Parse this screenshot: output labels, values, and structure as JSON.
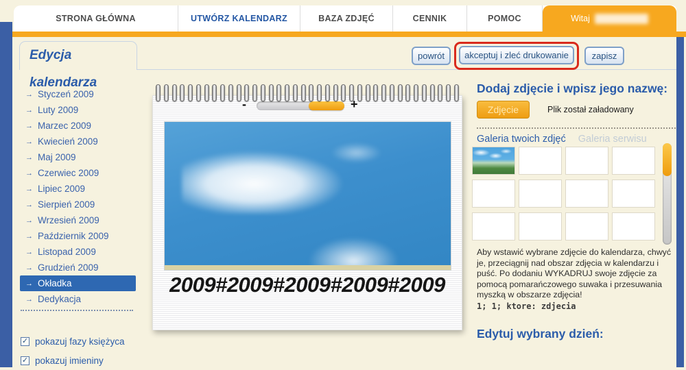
{
  "nav": {
    "tabs": [
      {
        "label": "STRONA GŁÓWNA",
        "active": false
      },
      {
        "label": "UTWÓRZ KALENDARZ",
        "active": true
      },
      {
        "label": "BAZA ZDJĘĆ",
        "active": false
      },
      {
        "label": "CENNIK",
        "active": false
      },
      {
        "label": "POMOC",
        "active": false
      }
    ],
    "welcome_label": "Witaj",
    "welcome_name_redacted": true
  },
  "page": {
    "title": "Edycja kalendarza"
  },
  "toolbar": {
    "back_label": "powrót",
    "accept_label": "akceptuj i zleć drukowanie",
    "save_label": "zapisz"
  },
  "sidebar": {
    "items": [
      {
        "label": "Styczeń 2009",
        "selected": false
      },
      {
        "label": "Luty 2009",
        "selected": false
      },
      {
        "label": "Marzec 2009",
        "selected": false
      },
      {
        "label": "Kwiecień 2009",
        "selected": false
      },
      {
        "label": "Maj 2009",
        "selected": false
      },
      {
        "label": "Czerwiec 2009",
        "selected": false
      },
      {
        "label": "Lipiec 2009",
        "selected": false
      },
      {
        "label": "Sierpień 2009",
        "selected": false
      },
      {
        "label": "Wrzesień 2009",
        "selected": false
      },
      {
        "label": "Październik 2009",
        "selected": false
      },
      {
        "label": "Listopad 2009",
        "selected": false
      },
      {
        "label": "Grudzień 2009",
        "selected": false
      },
      {
        "label": "Okładka",
        "selected": true
      },
      {
        "label": "Dedykacja",
        "selected": false
      }
    ],
    "checkboxes": [
      {
        "label": "pokazuj fazy księżyca",
        "checked": true
      },
      {
        "label": "pokazuj imieniny",
        "checked": true
      }
    ]
  },
  "calendar_preview": {
    "zoom_out_label": "-",
    "zoom_in_label": "+",
    "zoom_slider": {
      "fill_percent": 41,
      "fill_side": "right"
    },
    "cover_title": "2009#2009#2009#2009#2009",
    "spiral_ring_count": 38
  },
  "photo_panel": {
    "heading": "Dodaj zdjęcie i wpisz jego nazwę:",
    "upload_button_label": "Zdjęcie",
    "upload_status": "Plik został załadowany",
    "gallery_tabs": [
      {
        "label": "Galeria twoich zdjęć",
        "active": true
      },
      {
        "label": "Galeria serwisu",
        "active": false
      }
    ],
    "grid": {
      "rows": 3,
      "cols": 4,
      "filled_cells": 1
    },
    "instructions": "Aby wstawić wybrane zdjęcie do kalendarza, chwyć je, przeciągnij nad obszar zdjęcia w kalendarzu i puść. Po dodaniu WYKADRUJ swoje zdjęcie za pomocą pomarańczowego suwaka i przesuwania myszką w obszarze zdjęcia!",
    "debug_text": "1; 1; ktore: zdjecia",
    "edit_day_heading": "Edytuj wybrany dzień:"
  },
  "colors": {
    "accent_orange": "#f7a81f",
    "brand_blue": "#2b5caa",
    "stripe_blue": "#3b5fa5",
    "selected_item_bg": "#2e68b2",
    "highlight_red": "#d92a1c"
  }
}
